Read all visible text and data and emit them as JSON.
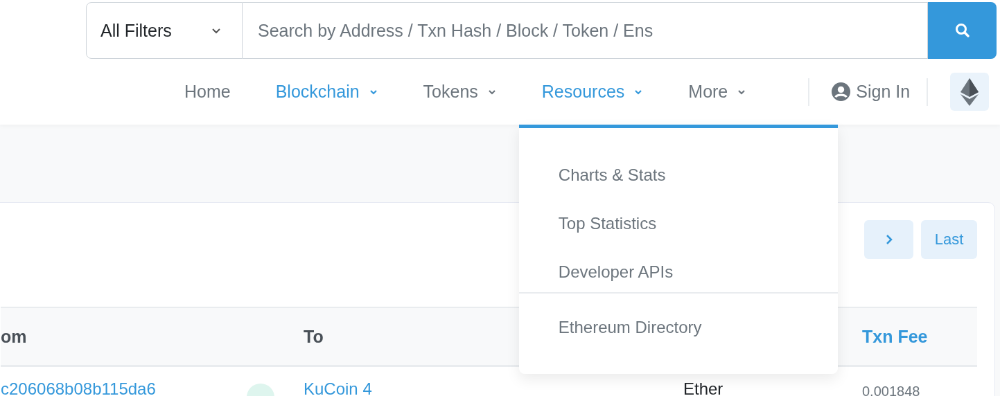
{
  "search": {
    "filter": "All Filters",
    "placeholder": "Search by Address / Txn Hash / Block / Token / Ens"
  },
  "nav": [
    {
      "label": "Home",
      "has_menu": false,
      "selected": false,
      "expanded": false
    },
    {
      "label": "Blockchain",
      "has_menu": true,
      "selected": true,
      "expanded": false
    },
    {
      "label": "Tokens",
      "has_menu": true,
      "selected": false,
      "expanded": false
    },
    {
      "label": "Resources",
      "has_menu": true,
      "selected": true,
      "expanded": true
    },
    {
      "label": "More",
      "has_menu": true,
      "selected": false,
      "expanded": false
    }
  ],
  "sign_in": "Sign In",
  "dropdown": {
    "groups": [
      [
        "Charts & Stats",
        "Top Statistics",
        "Developer APIs"
      ],
      [
        "Ethereum Directory"
      ]
    ]
  },
  "pager": {
    "last": "Last"
  },
  "table": {
    "columns": [
      {
        "label": "om",
        "sortable": false
      },
      {
        "label": "To",
        "sortable": false
      },
      {
        "label": "Txn Fee",
        "sortable": true
      }
    ],
    "rows": [
      {
        "from": "c206068b08b115da6",
        "to": "KuCoin 4",
        "value": "Ether",
        "fee": "0.001848"
      }
    ]
  }
}
